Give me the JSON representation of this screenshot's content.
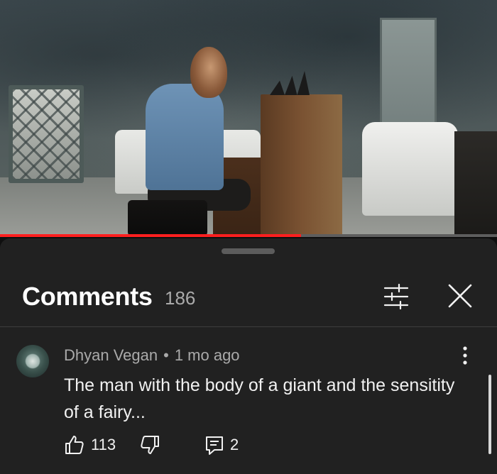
{
  "video": {
    "progress_fraction": 0.605,
    "progress_color": "#ff1f1f"
  },
  "comments_panel": {
    "title": "Comments",
    "count": "186",
    "filter_icon": "sliders-icon",
    "close_icon": "close-icon"
  },
  "comment": {
    "author": "Dhyan Vegan",
    "separator": "•",
    "time": "1 mo ago",
    "text": "The man with the body of a giant and the sensitity of a fairy...",
    "likes": "113",
    "replies": "2",
    "like_icon": "thumbs-up-icon",
    "dislike_icon": "thumbs-down-icon",
    "reply_icon": "reply-icon",
    "more_icon": "more-vertical-icon"
  }
}
